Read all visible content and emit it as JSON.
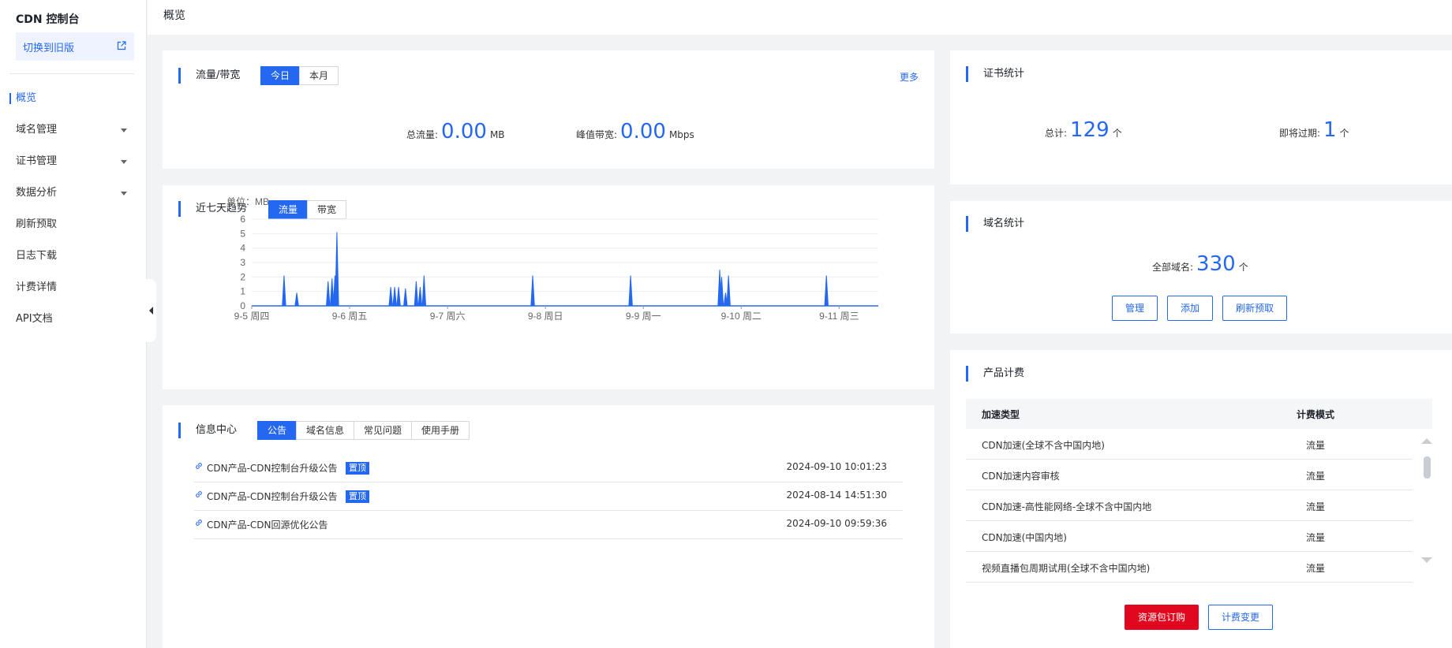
{
  "sidebar": {
    "title": "CDN 控制台",
    "switch_label": "切换到旧版",
    "items": [
      {
        "label": "概览",
        "active": true,
        "has_caret": false
      },
      {
        "label": "域名管理",
        "active": false,
        "has_caret": true
      },
      {
        "label": "证书管理",
        "active": false,
        "has_caret": true
      },
      {
        "label": "数据分析",
        "active": false,
        "has_caret": true
      },
      {
        "label": "刷新预取",
        "active": false,
        "has_caret": false
      },
      {
        "label": "日志下载",
        "active": false,
        "has_caret": false
      },
      {
        "label": "计费详情",
        "active": false,
        "has_caret": false
      },
      {
        "label": "API文档",
        "active": false,
        "has_caret": false
      }
    ]
  },
  "header": {
    "breadcrumb": "概览"
  },
  "traffic": {
    "title": "流量/带宽",
    "tabs": [
      "今日",
      "本月"
    ],
    "active_tab": 0,
    "more": "更多",
    "total_label": "总流量:",
    "total_value": "0.00",
    "total_unit": "MB",
    "peak_label": "峰值带宽:",
    "peak_value": "0.00",
    "peak_unit": "Mbps"
  },
  "trend": {
    "title": "近七天趋势",
    "tabs": [
      "流量",
      "带宽"
    ],
    "active_tab": 0,
    "unit_label": "单位：MB"
  },
  "chart_data": {
    "type": "area",
    "title": "",
    "ylabel": "单位：MB",
    "ylim": [
      0,
      6
    ],
    "yticks": [
      "0",
      "1",
      "2",
      "3",
      "4",
      "5",
      "6"
    ],
    "xticks": [
      "9-5 周四",
      "9-6 周五",
      "9-7 周六",
      "9-8 周日",
      "9-9 周一",
      "9-10 周二",
      "9-11 周三"
    ],
    "xlim": [
      0,
      6.4
    ],
    "color": "#2468f2",
    "spikes": [
      {
        "x": 0.33,
        "y": 2.1
      },
      {
        "x": 0.46,
        "y": 0.9
      },
      {
        "x": 0.78,
        "y": 1.7
      },
      {
        "x": 0.82,
        "y": 1.9
      },
      {
        "x": 0.85,
        "y": 2.1
      },
      {
        "x": 0.87,
        "y": 5.1
      },
      {
        "x": 1.42,
        "y": 1.3
      },
      {
        "x": 1.46,
        "y": 1.3
      },
      {
        "x": 1.5,
        "y": 1.3
      },
      {
        "x": 1.57,
        "y": 1.2
      },
      {
        "x": 1.68,
        "y": 1.7
      },
      {
        "x": 1.72,
        "y": 1.3
      },
      {
        "x": 1.76,
        "y": 2.1
      },
      {
        "x": 2.87,
        "y": 2.1
      },
      {
        "x": 3.87,
        "y": 2.1
      },
      {
        "x": 4.78,
        "y": 2.5
      },
      {
        "x": 4.8,
        "y": 2.0
      },
      {
        "x": 4.84,
        "y": 0.9
      },
      {
        "x": 4.87,
        "y": 2.1
      },
      {
        "x": 5.87,
        "y": 2.1
      }
    ]
  },
  "info": {
    "title": "信息中心",
    "tabs": [
      "公告",
      "域名信息",
      "常见问题",
      "使用手册"
    ],
    "active_tab": 0,
    "rows": [
      {
        "title": "CDN产品-CDN控制台升级公告",
        "pinned": true,
        "pin_label": "置顶",
        "time": "2024-09-10 10:01:23"
      },
      {
        "title": "CDN产品-CDN控制台升级公告",
        "pinned": true,
        "pin_label": "置顶",
        "time": "2024-08-14 14:51:30"
      },
      {
        "title": "CDN产品-CDN回源优化公告",
        "pinned": false,
        "pin_label": "",
        "time": "2024-09-10 09:59:36"
      }
    ]
  },
  "cert": {
    "title": "证书统计",
    "total_label": "总计:",
    "total_value": "129",
    "total_unit": "个",
    "expiring_label": "即将过期:",
    "expiring_value": "1",
    "expiring_unit": "个"
  },
  "domain": {
    "title": "域名统计",
    "all_label": "全部域名:",
    "all_value": "330",
    "all_unit": "个",
    "buttons": [
      "管理",
      "添加",
      "刷新预取"
    ]
  },
  "billing": {
    "title": "产品计费",
    "col_type": "加速类型",
    "col_mode": "计费模式",
    "rows": [
      {
        "type": "CDN加速(全球不含中国内地)",
        "mode": "流量"
      },
      {
        "type": "CDN加速内容审核",
        "mode": "流量"
      },
      {
        "type": "CDN加速-高性能网络-全球不含中国内地",
        "mode": "流量"
      },
      {
        "type": "CDN加速(中国内地)",
        "mode": "流量"
      },
      {
        "type": "视频直播包周期试用(全球不含中国内地)",
        "mode": "流量"
      }
    ],
    "buy_label": "资源包订购",
    "change_label": "计费变更"
  },
  "colors": {
    "accent": "#2468f2",
    "danger": "#e0071e",
    "background": "#f2f3f5"
  }
}
